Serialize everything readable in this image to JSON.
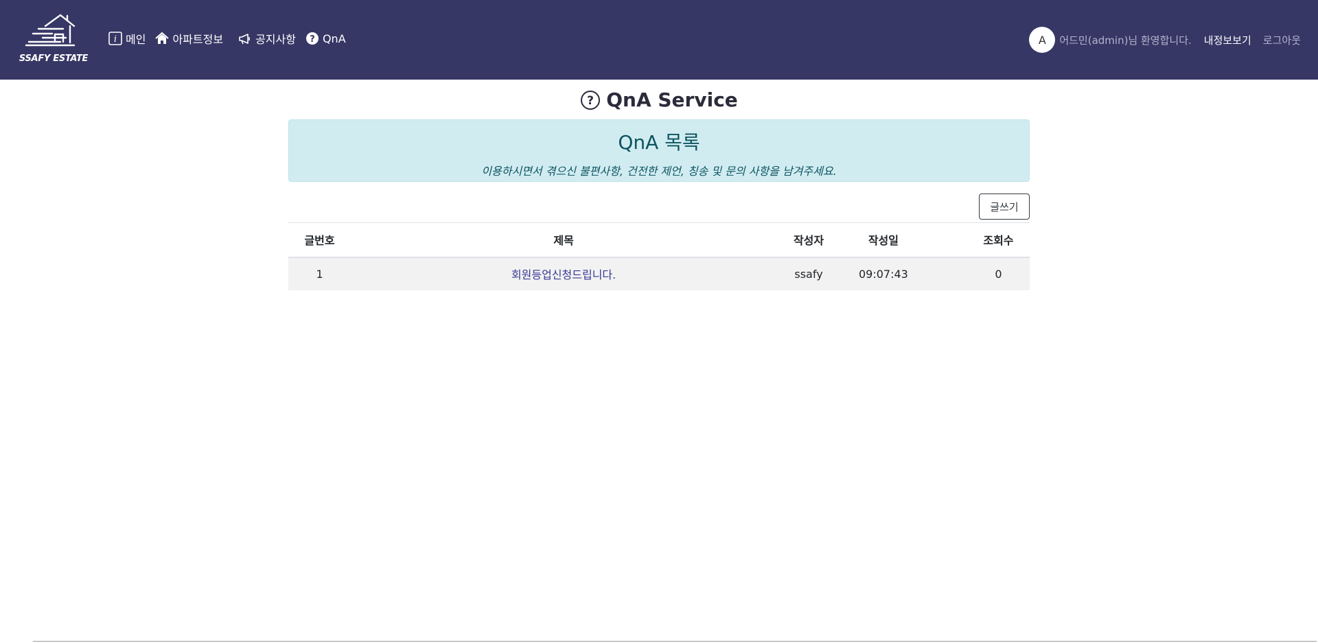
{
  "brand": {
    "name": "SSAFY ESTATE"
  },
  "nav": {
    "main": "메인",
    "apt": "아파트정보",
    "notice": "공지사항",
    "qna": "QnA"
  },
  "user": {
    "avatar_letter": "A",
    "welcome": "어드민(admin)님 환영합니다.",
    "mypage": "내정보보기",
    "logout": "로그아웃"
  },
  "page": {
    "title": "QnA Service",
    "banner_title": "QnA 목록",
    "banner_desc": "이용하시면서 겪으신 불편사항, 건전한 제언, 칭송 및 문의 사항을 남겨주세요.",
    "write_button": "글쓰기"
  },
  "table": {
    "headers": {
      "no": "글번호",
      "title": "제목",
      "writer": "작성자",
      "date": "작성일",
      "views": "조회수"
    },
    "rows": [
      {
        "no": "1",
        "title": "회원등업신청드립니다.",
        "writer": "ssafy",
        "date": "09:07:43",
        "views": "0"
      }
    ]
  },
  "colors": {
    "navbar": "#363765",
    "banner": "#d1ecf1",
    "link": "#363795"
  }
}
